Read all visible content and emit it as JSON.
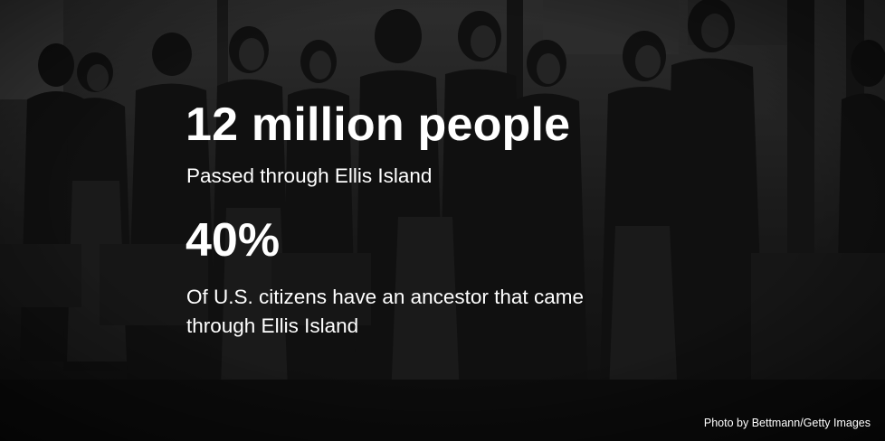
{
  "stats": [
    {
      "value": "12 million people",
      "description": "Passed through Ellis Island"
    },
    {
      "value": "40%",
      "description": "Of U.S. citizens have an ancestor that came through Ellis Island"
    }
  ],
  "photo_credit": "Photo by Bettmann/Getty Images",
  "colors": {
    "text": "#ffffff",
    "background": "#0f0f0f"
  }
}
